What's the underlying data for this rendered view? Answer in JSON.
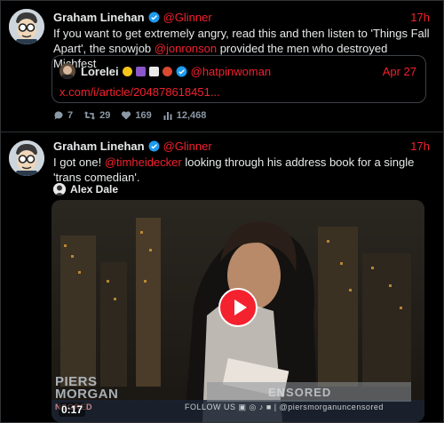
{
  "colors": {
    "accent": "#f4212e",
    "verified": "#1d9bf0",
    "muted": "#8b98a5",
    "text": "#e7e9ea"
  },
  "tweets": [
    {
      "author": "Graham Linehan",
      "handle": "@Glinner",
      "time": "17h",
      "text_parts": [
        "If you want to get extremely angry, read this and then listen to 'Things Fall Apart', the snowjob ",
        "@jonronson",
        " provided the men who destroyed Michfest"
      ],
      "quote": {
        "author": "Lorelei",
        "handle": "@hatpinwoman",
        "date": "Apr 27",
        "link": "x.com/i/article/204878618451..."
      },
      "actions": {
        "replies": "7",
        "retweets": "29",
        "likes": "169",
        "views": "12,468"
      }
    },
    {
      "author": "Graham Linehan",
      "handle": "@Glinner",
      "time": "17h",
      "text_parts": [
        "I got one! ",
        "@timheidecker",
        " looking through his address book for a single 'trans comedian'."
      ],
      "video": {
        "byline": "Alex Dale",
        "duration": "0:17",
        "watermark_line1": "PIERS",
        "watermark_line2": "MORGAN",
        "watermark_line3": "NCORED",
        "banner_right": "ENSORED",
        "follow_text": "FOLLOW US  ▣ ◎ ♪ ■ | @piersmorganuncensored"
      }
    }
  ]
}
